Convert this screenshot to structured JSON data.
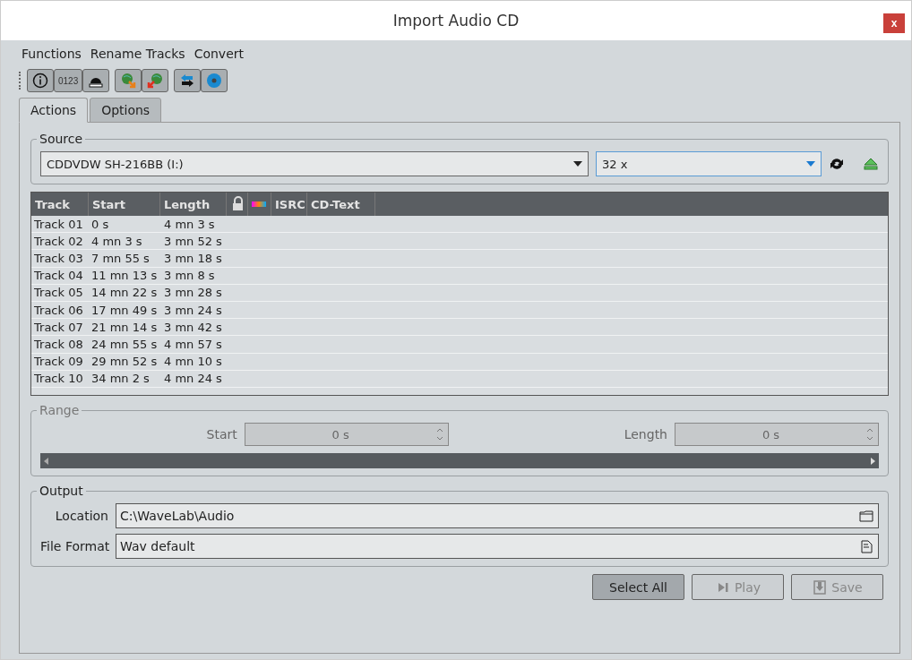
{
  "window": {
    "title": "Import Audio CD",
    "close": "x"
  },
  "menu": [
    "Functions",
    "Rename Tracks",
    "Convert"
  ],
  "toolbar": [
    {
      "kind": "info"
    },
    {
      "kind": "numbers",
      "label": "0123"
    },
    {
      "kind": "eject-drive"
    },
    {
      "kind": "globe-in"
    },
    {
      "kind": "globe-out"
    },
    {
      "kind": "swap"
    },
    {
      "kind": "disc"
    }
  ],
  "tabs": [
    {
      "label": "Actions",
      "selected": true
    },
    {
      "label": "Options",
      "selected": false
    }
  ],
  "source": {
    "title": "Source",
    "drive": "CDDVDW SH-216BB (I:)",
    "speed": "32 x"
  },
  "table": {
    "columns": [
      {
        "kind": "text",
        "label": "Track"
      },
      {
        "kind": "text",
        "label": "Start"
      },
      {
        "kind": "text",
        "label": "Length"
      },
      {
        "kind": "lock"
      },
      {
        "kind": "color"
      },
      {
        "kind": "text",
        "label": "ISRC"
      },
      {
        "kind": "text",
        "label": "CD-Text"
      }
    ],
    "rows": [
      [
        "Track 01",
        "0 s",
        "4 mn 3 s"
      ],
      [
        "Track 02",
        "4 mn 3 s",
        "3 mn 52 s"
      ],
      [
        "Track 03",
        "7 mn 55 s",
        "3 mn 18 s"
      ],
      [
        "Track 04",
        "11 mn 13 s",
        "3 mn 8 s"
      ],
      [
        "Track 05",
        "14 mn 22 s",
        "3 mn 28 s"
      ],
      [
        "Track 06",
        "17 mn 49 s",
        "3 mn 24 s"
      ],
      [
        "Track 07",
        "21 mn 14 s",
        "3 mn 42 s"
      ],
      [
        "Track 08",
        "24 mn 55 s",
        "4 mn 57 s"
      ],
      [
        "Track 09",
        "29 mn 52 s",
        "4 mn 10 s"
      ],
      [
        "Track 10",
        "34 mn 2 s",
        "4 mn 24 s"
      ]
    ]
  },
  "range": {
    "title": "Range",
    "disabled": true,
    "start_label": "Start",
    "start": "0 s",
    "length_label": "Length",
    "length": "0 s"
  },
  "output": {
    "title": "Output",
    "location_label": "Location",
    "location": "C:\\WaveLab\\Audio",
    "format_label": "File Format",
    "format": "Wav default"
  },
  "buttons": [
    {
      "label": "Select All",
      "kind": "plain",
      "disabled": false
    },
    {
      "label": "Play",
      "kind": "play",
      "disabled": true
    },
    {
      "label": "Save",
      "kind": "save",
      "disabled": true
    }
  ]
}
